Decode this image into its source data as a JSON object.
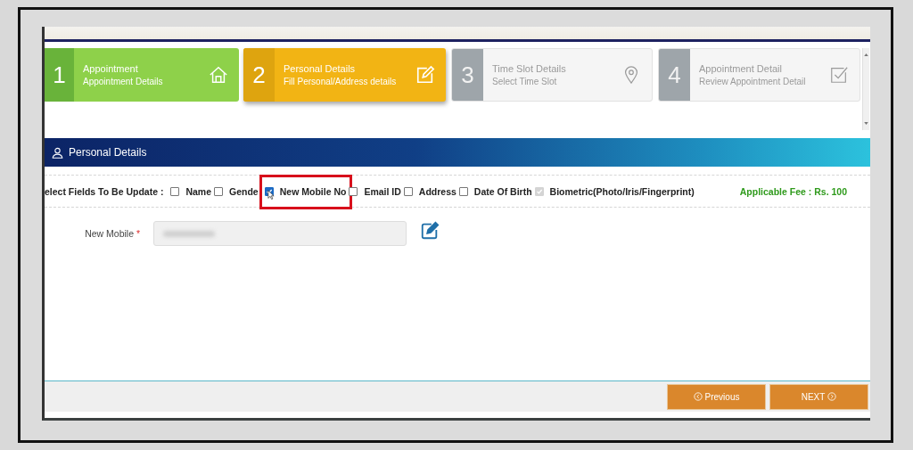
{
  "steps": [
    {
      "number": "1",
      "title": "Appointment",
      "subtitle": "Appointment Details",
      "completed": true,
      "selected": false
    },
    {
      "number": "2",
      "title": "Personal Details",
      "subtitle": "Fill Personal/Address details",
      "completed": false,
      "selected": true
    },
    {
      "number": "3",
      "title": "Time Slot Details",
      "subtitle": "Select Time Slot",
      "completed": false,
      "selected": false
    },
    {
      "number": "4",
      "title": "Appointment Detail",
      "subtitle": "Review Appointment Detail",
      "completed": false,
      "selected": false
    }
  ],
  "section": {
    "title": "Personal Details"
  },
  "fields_selector": {
    "label": "elect Fields To Be Update :",
    "options": [
      {
        "label": "Name",
        "checked": false,
        "disabled": false,
        "highlighted": false
      },
      {
        "label": "Gende",
        "checked": false,
        "disabled": false,
        "highlighted": false
      },
      {
        "label": "New Mobile No",
        "checked": true,
        "disabled": false,
        "highlighted": true
      },
      {
        "label": "Email ID",
        "checked": false,
        "disabled": false,
        "highlighted": false
      },
      {
        "label": "Address",
        "checked": false,
        "disabled": false,
        "highlighted": false
      },
      {
        "label": "Date Of Birth",
        "checked": false,
        "disabled": false,
        "highlighted": false
      },
      {
        "label": "Biometric(Photo/Iris/Fingerprint)",
        "checked": true,
        "disabled": true,
        "highlighted": false
      }
    ],
    "fee": "Applicable Fee : Rs. 100"
  },
  "form": {
    "label": "New Mobile",
    "required_mark": "*"
  },
  "buttons": [
    {
      "kind": "previous",
      "label": "Previous"
    },
    {
      "kind": "next",
      "label": "NEXT"
    }
  ]
}
